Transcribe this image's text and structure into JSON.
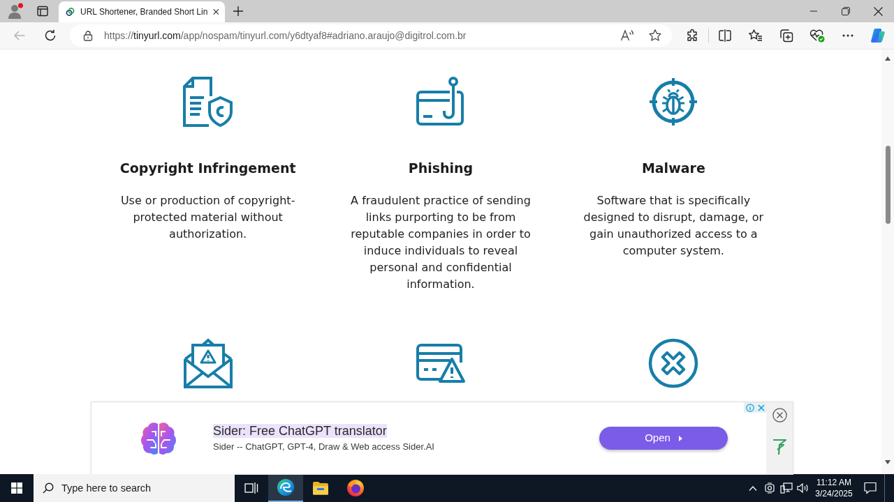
{
  "browser": {
    "tabs": [
      {
        "title": "URL Shortener, Branded Short Lin",
        "selected": true
      }
    ],
    "back": {
      "disabled": true
    },
    "address": "https://**tinyurl.com**/app/nospam/tinyurl.com/y6dtyaf8#adriano.araujo@digitrol.com.br"
  },
  "features": [
    {
      "title": "Copyright Infringement",
      "description": "Use or production of copyright-protected material without authorization."
    },
    {
      "title": "Phishing",
      "description": "A fraudulent practice of sending links purporting to be from reputable companies in order to induce individuals to reveal personal and confidential information."
    },
    {
      "title": "Malware",
      "description": "Software that is specifically designed to disrupt, damage, or gain unauthorized access to a computer system."
    }
  ],
  "ad": {
    "title": "Sider: Free ChatGPT translator",
    "subtitle": "Sider -- ChatGPT, GPT-4, Draw & Web access Sider.AI",
    "button": "Open"
  },
  "taskbar": {
    "search_placeholder": "Type here to search",
    "time": "11:12 AM",
    "date": "3/24/2025"
  }
}
